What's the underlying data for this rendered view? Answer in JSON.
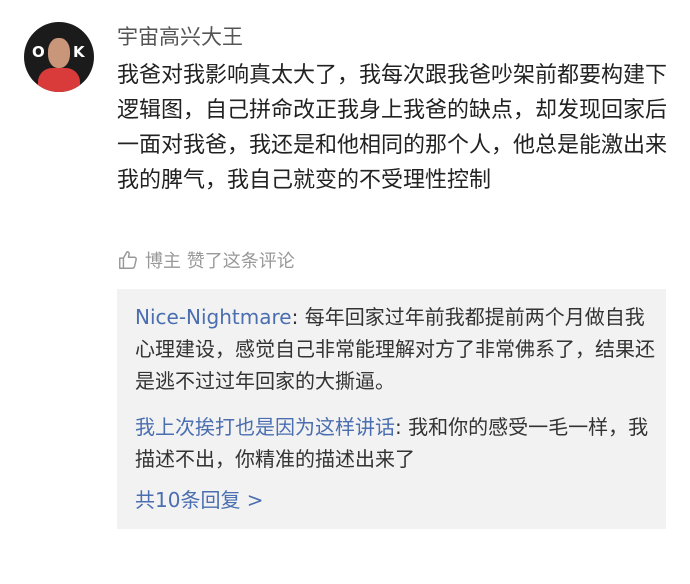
{
  "comment": {
    "username": "宇宙高兴大王",
    "text": "我爸对我影响真太大了，我每次跟我爸吵架前都要构建下逻辑图，自己拼命改正我身上我爸的缺点，却发现回家后一面对我爸，我还是和他相同的那个人，他总是能激出来我的脾气，我自己就变的不受理性控制",
    "liked_by": "博主 赞了这条评论",
    "avatar_text_left": "O",
    "avatar_text_right": "K"
  },
  "replies": [
    {
      "name": "Nice-Nightmare",
      "separator": ": ",
      "text": "每年回家过年前我都提前两个月做自我心理建设，感觉自己非常能理解对方了非常佛系了，结果还是逃不过过年回家的大撕逼。"
    },
    {
      "name": "我上次挨打也是因为这样讲话",
      "separator": ": ",
      "text": "我和你的感受一毛一样，我描述不出，你精准的描述出来了"
    }
  ],
  "more_replies": "共10条回复 >"
}
